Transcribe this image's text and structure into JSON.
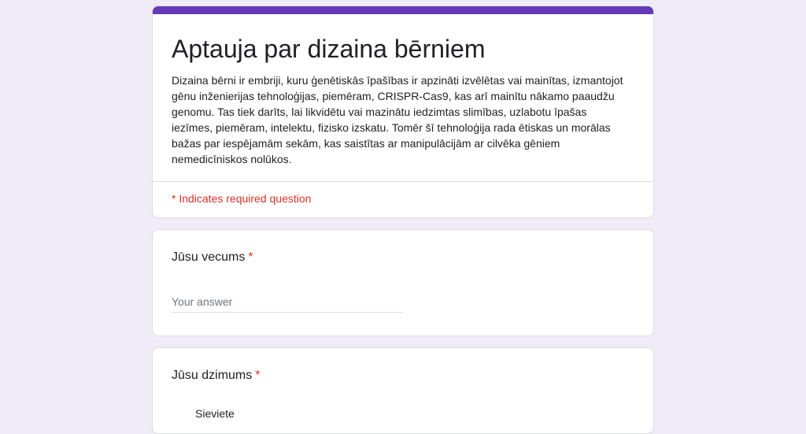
{
  "form": {
    "title": "Aptauja par dizaina bērniem",
    "description": "Dizaina bērni ir embriji, kuru ģenētiskās īpašības ir apzināti izvēlētas vai mainītas, izmantojot\ngēnu inženierijas tehnoloģijas, piemēram, CRISPR-Cas9, kas arī mainītu nākamo paaudžu\ngenomu. Tas tiek darīts, lai likvidētu vai mazinātu iedzimtas slimības, uzlabotu īpašas\niezīmes, piemēram, intelektu, fizisko izskatu. Tomēr šī tehnoloģija rada ētiskas un morālas\nbažas par iespējamām sekām, kas saistītas ar manipulācijām ar cilvēka gēniem\nnemedicīniskos nolūkos.",
    "required_note": "* Indicates required question",
    "accent_color": "#673ab7",
    "required_color": "#d93025"
  },
  "questions": [
    {
      "title": "Jūsu vecums",
      "required_mark": "*",
      "answer_placeholder": "Your answer"
    },
    {
      "title": "Jūsu dzimums",
      "required_mark": "*",
      "options": [
        "Sieviete"
      ]
    }
  ]
}
